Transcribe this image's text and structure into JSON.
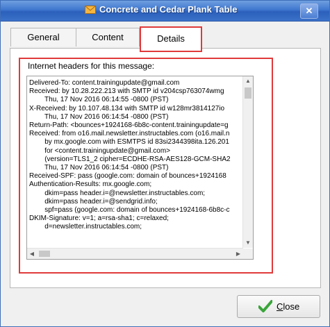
{
  "window": {
    "title": "Concrete and Cedar Plank Table",
    "close_glyph": "✕"
  },
  "tabs": [
    {
      "label": "General"
    },
    {
      "label": "Content"
    },
    {
      "label": "Details",
      "selected": true
    }
  ],
  "details": {
    "headers_label": "Internet headers for this message:",
    "headers_text": "Delivered-To: content.trainingupdate@gmail.com\nReceived: by 10.28.222.213 with SMTP id v204csp763074wmg\n        Thu, 17 Nov 2016 06:14:55 -0800 (PST)\nX-Received: by 10.107.48.134 with SMTP id w128mr3814127io\n        Thu, 17 Nov 2016 06:14:54 -0800 (PST)\nReturn-Path: <bounces+1924168-6b8c-content.trainingupdate=g\nReceived: from o16.mail.newsletter.instructables.com (o16.mail.n\n        by mx.google.com with ESMTPS id 83si2344398ita.126.201\n        for <content.trainingupdate@gmail.com>\n        (version=TLS1_2 cipher=ECDHE-RSA-AES128-GCM-SHA2\n        Thu, 17 Nov 2016 06:14:54 -0800 (PST)\nReceived-SPF: pass (google.com: domain of bounces+1924168\nAuthentication-Results: mx.google.com;\n        dkim=pass header.i=@newsletter.instructables.com;\n        dkim=pass header.i=@sendgrid.info;\n        spf=pass (google.com: domain of bounces+1924168-6b8c-c\nDKIM-Signature: v=1; a=rsa-sha1; c=relaxed;\n        d=newsletter.instructables.com;"
  },
  "buttons": {
    "close_label_underlined": "C",
    "close_label_rest": "lose"
  },
  "icons": {
    "title": "envelope-icon",
    "close_button": "checkmark-icon"
  },
  "colors": {
    "titlebar": "#3f77cf",
    "highlight": "#e0393a",
    "checkmark": "#3aa53a"
  }
}
